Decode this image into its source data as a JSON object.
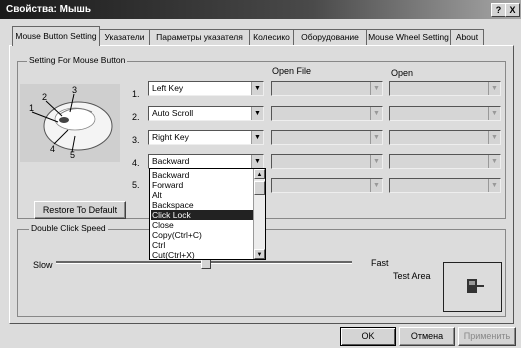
{
  "window": {
    "title": "Свойства: Мышь",
    "help_btn": "?",
    "close_btn": "X"
  },
  "tabs": [
    "Mouse Button Setting",
    "Указатели",
    "Параметры указателя",
    "Колесико",
    "Оборудование",
    "Mouse Wheel Setting",
    "About"
  ],
  "button_group": {
    "label": "Setting For Mouse Button",
    "header_open_file": "Open File",
    "header_open": "Open",
    "mouse_callouts": [
      "1",
      "2",
      "3",
      "4",
      "5"
    ],
    "rows": [
      {
        "num": "1.",
        "value": "Left Key"
      },
      {
        "num": "2.",
        "value": "Auto Scroll"
      },
      {
        "num": "3.",
        "value": "Right Key"
      },
      {
        "num": "4.",
        "value": "Backward"
      },
      {
        "num": "5.",
        "value": ""
      }
    ],
    "dropdown_options": [
      "Backward",
      "Forward",
      "Alt",
      "Backspace",
      "Click Lock",
      "Close",
      "Copy(Ctrl+C)",
      "Ctrl",
      "Cut(Ctrl+X)"
    ],
    "dropdown_selected": "Click Lock",
    "restore_label": "Restore To Default"
  },
  "double_click": {
    "label": "Double Click Speed",
    "slow": "Slow",
    "fast": "Fast",
    "test_area": "Test Area",
    "speed_fraction": 0.5
  },
  "footer": {
    "ok": "OK",
    "cancel": "Отмена",
    "apply": "Применить"
  }
}
